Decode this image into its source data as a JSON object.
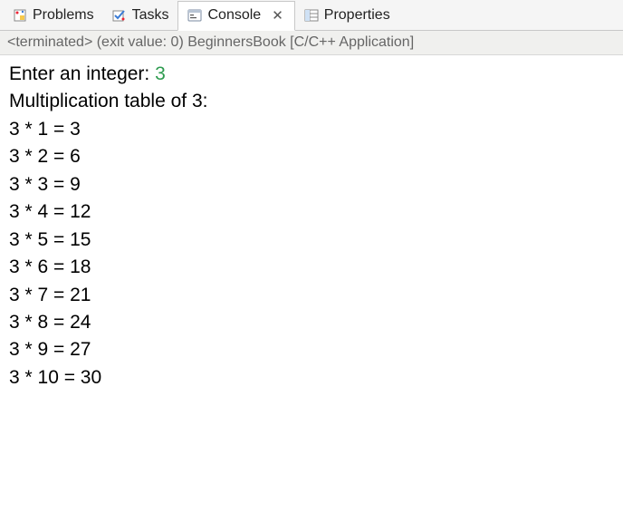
{
  "tabs": [
    {
      "label": "Problems",
      "active": false,
      "closable": false
    },
    {
      "label": "Tasks",
      "active": false,
      "closable": false
    },
    {
      "label": "Console",
      "active": true,
      "closable": true
    },
    {
      "label": "Properties",
      "active": false,
      "closable": false
    }
  ],
  "status_text": "<terminated> (exit value: 0) BeginnersBook [C/C++ Application]",
  "console": {
    "prompt": "Enter an integer: ",
    "input_value": "3",
    "header": "Multiplication table of 3:",
    "lines": [
      "3 * 1 = 3",
      "3 * 2 = 6",
      "3 * 3 = 9",
      "3 * 4 = 12",
      "3 * 5 = 15",
      "3 * 6 = 18",
      "3 * 7 = 21",
      "3 * 8 = 24",
      "3 * 9 = 27",
      "3 * 10 = 30"
    ]
  }
}
